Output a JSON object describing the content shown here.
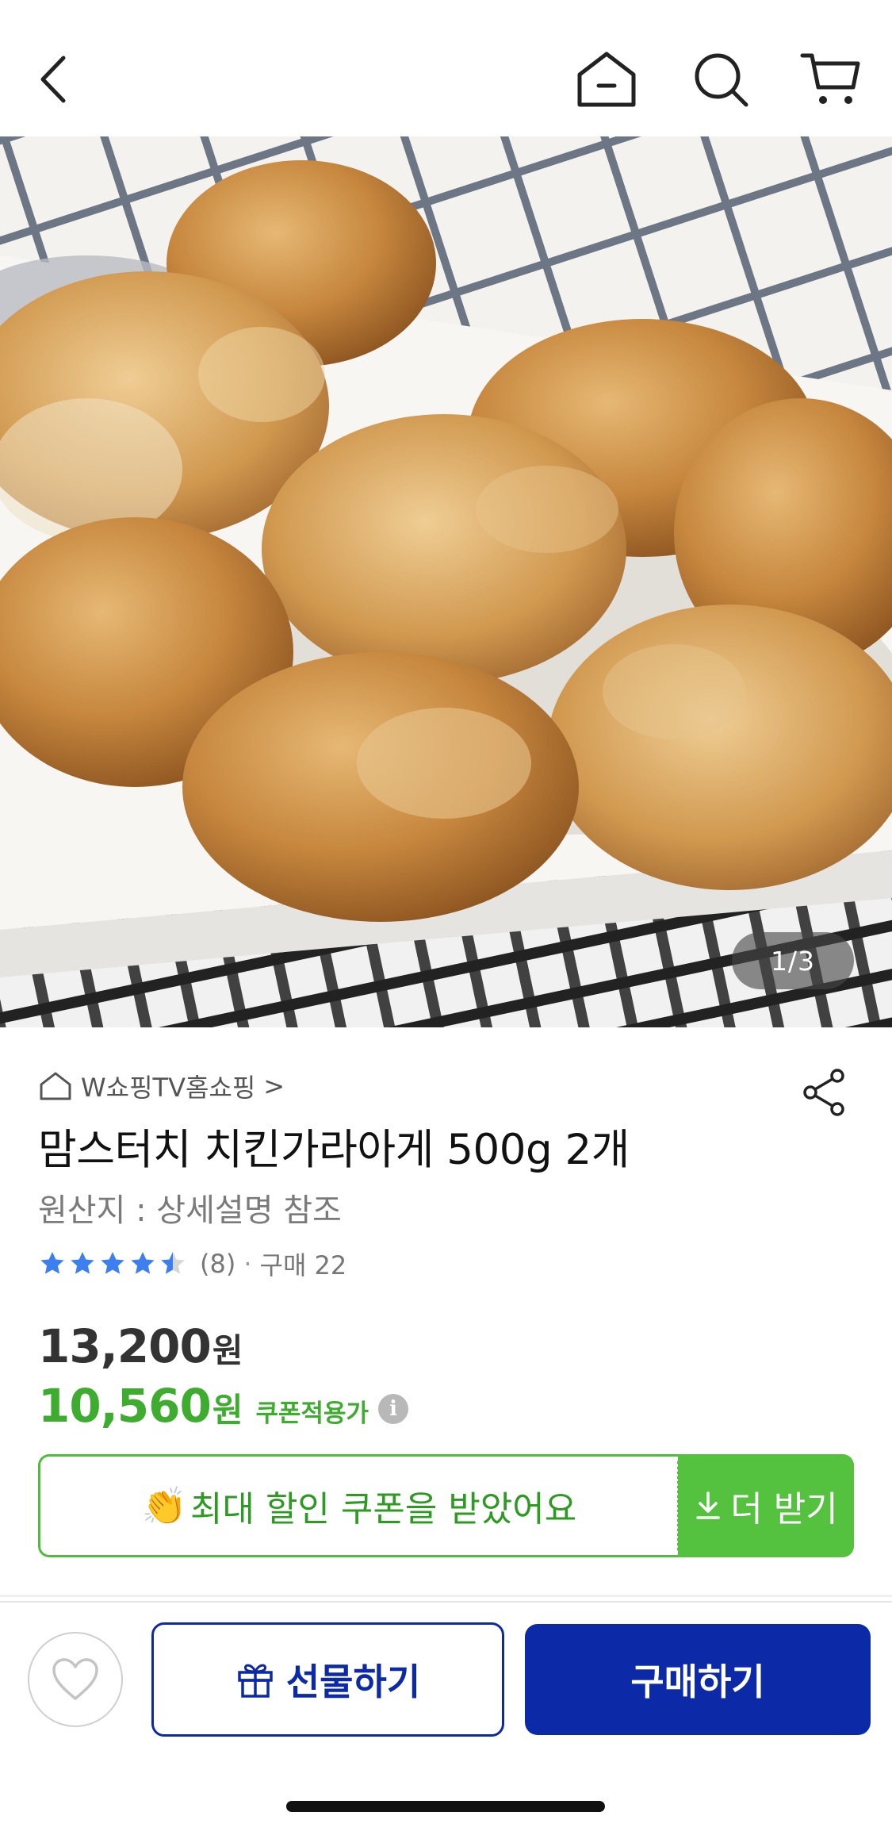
{
  "header": {
    "icons": [
      "back-icon",
      "home-icon",
      "search-icon",
      "cart-icon"
    ]
  },
  "gallery": {
    "page_indicator": "1/3"
  },
  "product": {
    "store_name": "W쇼핑TV홈쇼핑",
    "store_chevron": ">",
    "title": "맘스터치 치킨가라아게 500g 2개",
    "origin": "원산지 : 상세설명 참조",
    "rating": 4.5,
    "review_count": "(8)",
    "separator": "·",
    "purchase_count": "구매 22",
    "price_original": "13,200",
    "price_coupon": "10,560",
    "currency": "원",
    "coupon_price_label": "쿠폰적용가",
    "info_symbol": "i"
  },
  "coupon": {
    "emoji": "👏",
    "message": "최대 할인 쿠폰을 받았어요",
    "more_label": "더 받기"
  },
  "actions": {
    "gift_label": "선물하기",
    "buy_label": "구매하기"
  },
  "colors": {
    "primary": "#0c2aa8",
    "coupon_green": "#3eac2e",
    "coupon_button": "#55c23f",
    "star": "#3d7ff0"
  }
}
